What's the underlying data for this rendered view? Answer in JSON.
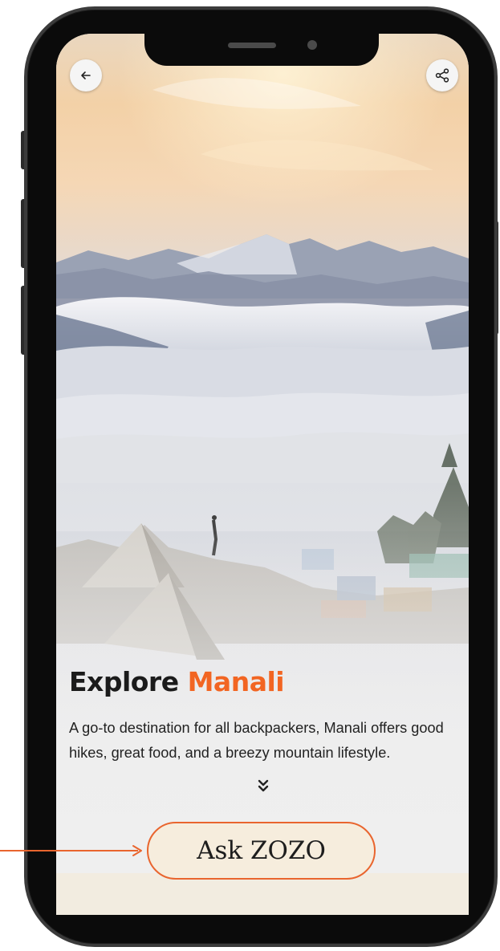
{
  "screen": {
    "title_prefix": "Explore",
    "title_highlight": "Manali",
    "description": "A go-to destination for all backpackers, Manali offers good hikes, great food, and a breezy mountain lifestyle."
  },
  "buttons": {
    "ask_label": "Ask ZOZO"
  },
  "icons": {
    "back": "back-arrow-icon",
    "share": "share-icon",
    "expand": "double-chevron-down-icon"
  },
  "colors": {
    "accent": "#f26522",
    "ask_border": "#e9652e",
    "ask_background": "#f6eddd"
  }
}
